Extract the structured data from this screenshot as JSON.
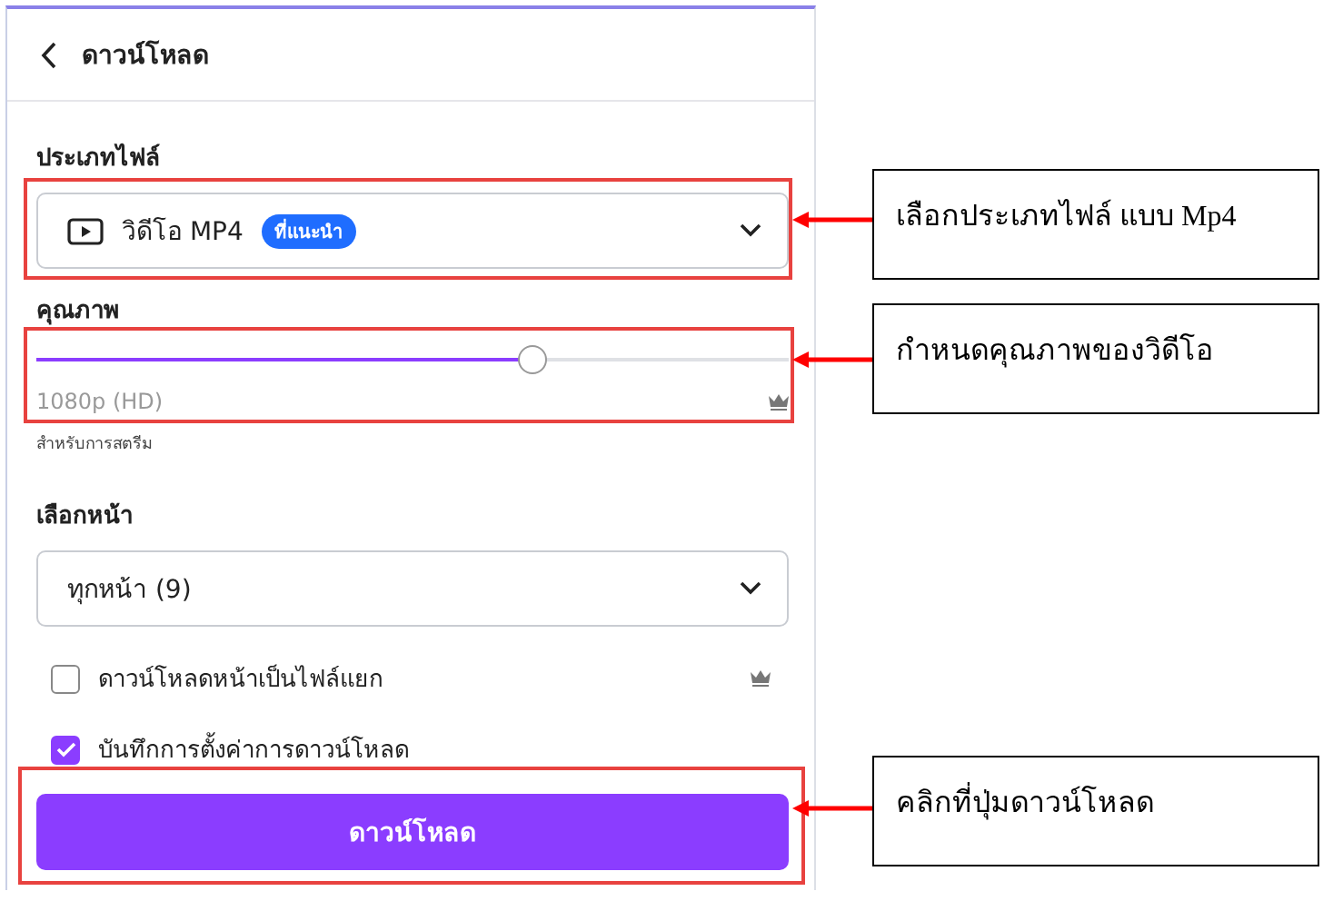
{
  "panel": {
    "title": "ดาวน์โหลด",
    "file_type": {
      "label": "ประเภทไฟล์",
      "value": "วิดีโอ MP4",
      "badge": "ที่แนะนำ"
    },
    "quality": {
      "label": "คุณภาพ",
      "level": 0.66,
      "reading": "1080p (HD)",
      "note": "สำหรับการสตรีม"
    },
    "pages": {
      "label": "เลือกหน้า",
      "value": "ทุกหน้า (9)"
    },
    "options": [
      {
        "label": "ดาวน์โหลดหน้าเป็นไฟล์แยก",
        "checked": false,
        "premium": true
      },
      {
        "label": "บันทึกการตั้งค่าการดาวน์โหลด",
        "checked": true,
        "premium": false
      }
    ],
    "button": "ดาวน์โหลด"
  },
  "callouts": [
    {
      "text": "เลือกประเภทไฟล์ แบบ Mp4"
    },
    {
      "text": "กำหนดคุณภาพของวิดีโอ"
    },
    {
      "text": "คลิกที่ปุ่มดาวน์โหลด"
    }
  ]
}
